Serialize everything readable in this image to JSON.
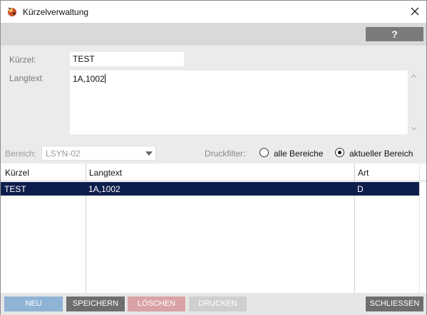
{
  "window": {
    "title": "Kürzelverwaltung"
  },
  "toolbar": {
    "help_label": "?"
  },
  "form": {
    "kuerzel_label": "Kürzel:",
    "kuerzel_value": "TEST",
    "langtext_label": "Langtext",
    "langtext_value": "1A,1002"
  },
  "filter": {
    "bereich_label": "Bereich:",
    "bereich_value": "LSYN-02",
    "druckfilter_label": "Druckfilter:",
    "options": [
      {
        "label": "alle Bereiche",
        "selected": false
      },
      {
        "label": "aktueller Bereich",
        "selected": true
      }
    ]
  },
  "table": {
    "columns": [
      "Kürzel",
      "Langtext",
      "Art"
    ],
    "rows": [
      {
        "kuerzel": "TEST",
        "langtext": "1A,1002",
        "art": "D"
      }
    ]
  },
  "footer": {
    "neu": "NEU",
    "speichern": "SPEICHERN",
    "loeschen": "LÖSCHEN",
    "drucken": "DRUCKEN",
    "schliessen": "SCHLIESSEN"
  },
  "colors": {
    "selected_row": "#0e1e4c",
    "neu_button": "#8fb3d4",
    "speichern_button": "#6e6e6e",
    "loeschen_button": "#d9a3a6",
    "drucken_button": "#cfcfcf",
    "schliessen_button": "#6e6e6e"
  }
}
